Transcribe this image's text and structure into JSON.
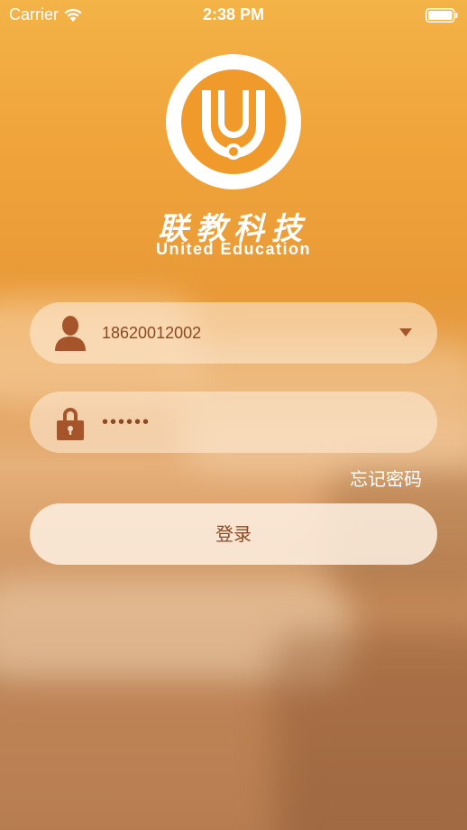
{
  "status_bar": {
    "carrier": "Carrier",
    "time": "2:38 PM"
  },
  "brand": {
    "chinese_name": "联教科技",
    "english_name": "United Education"
  },
  "login": {
    "username_value": "18620012002",
    "password_value": "••••••",
    "forgot_password_label": "忘记密码",
    "login_button_label": "登录"
  },
  "icons": {
    "user": "user-icon",
    "lock": "lock-icon",
    "dropdown": "chevron-down-icon",
    "wifi": "wifi-icon",
    "battery": "battery-icon",
    "logo": "united-education-logo"
  },
  "colors": {
    "accent": "#f0a33a",
    "field_text": "#8a4a22",
    "icon": "#a6552b",
    "white": "#ffffff"
  }
}
